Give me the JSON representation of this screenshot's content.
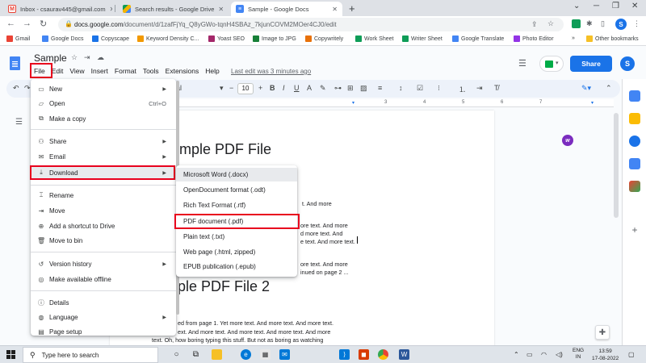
{
  "browser": {
    "tabs": [
      {
        "title": "Inbox - csaurav445@gmail.com",
        "favicon": "gmail-icon",
        "active": false
      },
      {
        "title": "Search results - Google Drive",
        "favicon": "drive-icon",
        "active": false
      },
      {
        "title": "Sample - Google Docs",
        "favicon": "docs-icon",
        "active": true
      }
    ],
    "new_tab": "+",
    "url_host": "docs.google.com",
    "url_path": "/document/d/1zafFjYq_Q8yGWo-tqnH4SBAz_7kjunCOVM2MOer4CJ0/edit",
    "profile_initial": "S",
    "bookmarks": [
      {
        "label": "Gmail",
        "color": "#ea4335"
      },
      {
        "label": "Google Docs",
        "color": "#4285f4"
      },
      {
        "label": "Copyscape",
        "color": "#1a73e8"
      },
      {
        "label": "Keyword Density C...",
        "color": "#f29900"
      },
      {
        "label": "Yoast SEO",
        "color": "#a4286a"
      },
      {
        "label": "Image to JPG",
        "color": "#188038"
      },
      {
        "label": "Copywritely",
        "color": "#e8710a"
      },
      {
        "label": "Work Sheet",
        "color": "#0f9d58"
      },
      {
        "label": "Writer Sheet",
        "color": "#0f9d58"
      },
      {
        "label": "Google Translate",
        "color": "#4285f4"
      },
      {
        "label": "Photo Editor",
        "color": "#9334e6"
      }
    ],
    "other_bookmarks": "Other bookmarks"
  },
  "docs": {
    "title": "Sample",
    "menus": [
      "File",
      "Edit",
      "View",
      "Insert",
      "Format",
      "Tools",
      "Extensions",
      "Help"
    ],
    "last_edit": "Last edit was 3 minutes ago",
    "share_label": "Share",
    "avatar_initial": "S",
    "font_size": "10",
    "font_name_fragment": "al",
    "ruler_numbers": [
      "3",
      "4",
      "5",
      "6",
      "7"
    ]
  },
  "document": {
    "heading1": "mple PDF File",
    "heading2": "ple PDF File 2",
    "lines": [
      "t. And more",
      "ore text. And more",
      "d more text. And",
      "e text. And more text.",
      "ore text. And more",
      "inued on page 2 ...",
      "ed from page 1. Yet more text. And more text. And more text.",
      "ext. And more text. And more text. And more text. And more",
      "text. Oh, how boring typing this stuff. But not as boring as watching"
    ]
  },
  "file_menu": {
    "items": [
      {
        "icon": "new-doc-icon",
        "glyph": "▭",
        "label": "New",
        "shortcut": "",
        "submenu": true
      },
      {
        "icon": "open-folder-icon",
        "glyph": "▱",
        "label": "Open",
        "shortcut": "Ctrl+O",
        "submenu": false
      },
      {
        "icon": "copy-icon",
        "glyph": "⧉",
        "label": "Make a copy",
        "shortcut": "",
        "submenu": false
      },
      {
        "icon": "share-person-icon",
        "glyph": "⚇",
        "label": "Share",
        "shortcut": "",
        "submenu": true
      },
      {
        "icon": "email-icon",
        "glyph": "✉",
        "label": "Email",
        "shortcut": "",
        "submenu": true
      },
      {
        "icon": "download-icon",
        "glyph": "⤓",
        "label": "Download",
        "shortcut": "",
        "submenu": true
      },
      {
        "icon": "rename-icon",
        "glyph": "⌶",
        "label": "Rename",
        "shortcut": "",
        "submenu": false
      },
      {
        "icon": "move-icon",
        "glyph": "⇥",
        "label": "Move",
        "shortcut": "",
        "submenu": false
      },
      {
        "icon": "drive-shortcut-icon",
        "glyph": "⊕",
        "label": "Add a shortcut to Drive",
        "shortcut": "",
        "submenu": false
      },
      {
        "icon": "trash-icon",
        "glyph": "🗑",
        "label": "Move to bin",
        "shortcut": "",
        "submenu": false
      },
      {
        "icon": "history-icon",
        "glyph": "↺",
        "label": "Version history",
        "shortcut": "",
        "submenu": true
      },
      {
        "icon": "offline-icon",
        "glyph": "◎",
        "label": "Make available offline",
        "shortcut": "",
        "submenu": false
      },
      {
        "icon": "info-icon",
        "glyph": "ⓘ",
        "label": "Details",
        "shortcut": "",
        "submenu": false
      },
      {
        "icon": "globe-icon",
        "glyph": "◍",
        "label": "Language",
        "shortcut": "",
        "submenu": true
      },
      {
        "icon": "page-setup-icon",
        "glyph": "▤",
        "label": "Page setup",
        "shortcut": "",
        "submenu": false
      }
    ]
  },
  "download_submenu": {
    "items": [
      "Microsoft Word (.docx)",
      "OpenDocument format (.odt)",
      "Rich Text Format (.rtf)",
      "PDF document (.pdf)",
      "Plain text (.txt)",
      "Web page (.html, zipped)",
      "EPUB publication (.epub)"
    ]
  },
  "taskbar": {
    "search_placeholder": "Type here to search",
    "lang_line1": "ENG",
    "lang_line2": "IN",
    "time": "13:59",
    "date": "17-08-2022"
  },
  "colors": {
    "highlight_red": "#e8001d",
    "share_blue": "#1a73e8"
  }
}
